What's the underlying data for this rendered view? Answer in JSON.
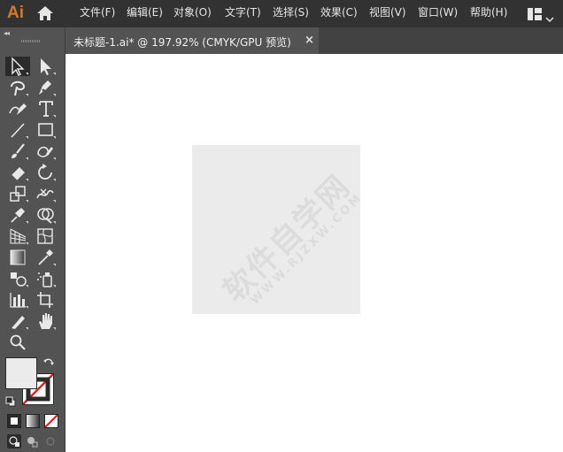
{
  "app": {
    "logo": "Ai"
  },
  "menu": [
    {
      "label": "文件(F)"
    },
    {
      "label": "编辑(E)"
    },
    {
      "label": "对象(O)"
    },
    {
      "label": "文字(T)"
    },
    {
      "label": "选择(S)"
    },
    {
      "label": "效果(C)"
    },
    {
      "label": "视图(V)"
    },
    {
      "label": "窗口(W)"
    },
    {
      "label": "帮助(H)"
    }
  ],
  "toolbar": {
    "collapse": "◂◂"
  },
  "document": {
    "tab_title": "未标题-1.ai* @ 197.92% (CMYK/GPU 预览)",
    "close": "×"
  },
  "watermark": {
    "text": "软件自学网",
    "url": "WWW.RJZXW.COM"
  },
  "colors": {
    "accent": "#d47a2f",
    "menubar": "#323232",
    "panel": "#535353",
    "tabbar": "#424242",
    "artboard": "#ebebeb",
    "stroke_none": "#e02020"
  },
  "tools": [
    "selection-tool-icon",
    "direct-selection-tool-icon",
    "magic-wand-tool-icon",
    "pen-tool-icon",
    "curvature-tool-icon",
    "type-tool-icon",
    "line-segment-tool-icon",
    "rectangle-tool-icon",
    "paintbrush-tool-icon",
    "shaper-tool-icon",
    "eraser-tool-icon",
    "rotate-tool-icon",
    "scale-tool-icon",
    "width-tool-icon",
    "puppet-warp-tool-icon",
    "shape-builder-tool-icon",
    "perspective-grid-tool-icon",
    "mesh-tool-icon",
    "gradient-tool-icon",
    "eyedropper-tool-icon",
    "blend-tool-icon",
    "symbol-sprayer-tool-icon",
    "column-graph-tool-icon",
    "artboard-tool-icon",
    "slice-tool-icon",
    "hand-tool-icon",
    "zoom-tool-icon"
  ]
}
